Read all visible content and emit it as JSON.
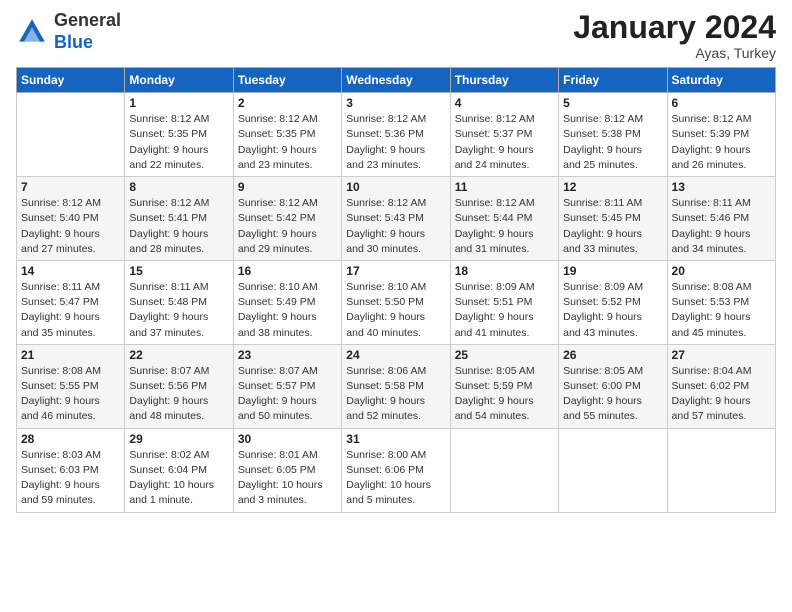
{
  "header": {
    "logo": {
      "general": "General",
      "blue": "Blue"
    },
    "month_title": "January 2024",
    "location": "Ayas, Turkey"
  },
  "weekdays": [
    "Sunday",
    "Monday",
    "Tuesday",
    "Wednesday",
    "Thursday",
    "Friday",
    "Saturday"
  ],
  "weeks": [
    [
      {
        "day": "",
        "info": ""
      },
      {
        "day": "1",
        "info": "Sunrise: 8:12 AM\nSunset: 5:35 PM\nDaylight: 9 hours\nand 22 minutes."
      },
      {
        "day": "2",
        "info": "Sunrise: 8:12 AM\nSunset: 5:35 PM\nDaylight: 9 hours\nand 23 minutes."
      },
      {
        "day": "3",
        "info": "Sunrise: 8:12 AM\nSunset: 5:36 PM\nDaylight: 9 hours\nand 23 minutes."
      },
      {
        "day": "4",
        "info": "Sunrise: 8:12 AM\nSunset: 5:37 PM\nDaylight: 9 hours\nand 24 minutes."
      },
      {
        "day": "5",
        "info": "Sunrise: 8:12 AM\nSunset: 5:38 PM\nDaylight: 9 hours\nand 25 minutes."
      },
      {
        "day": "6",
        "info": "Sunrise: 8:12 AM\nSunset: 5:39 PM\nDaylight: 9 hours\nand 26 minutes."
      }
    ],
    [
      {
        "day": "7",
        "info": "Sunrise: 8:12 AM\nSunset: 5:40 PM\nDaylight: 9 hours\nand 27 minutes."
      },
      {
        "day": "8",
        "info": "Sunrise: 8:12 AM\nSunset: 5:41 PM\nDaylight: 9 hours\nand 28 minutes."
      },
      {
        "day": "9",
        "info": "Sunrise: 8:12 AM\nSunset: 5:42 PM\nDaylight: 9 hours\nand 29 minutes."
      },
      {
        "day": "10",
        "info": "Sunrise: 8:12 AM\nSunset: 5:43 PM\nDaylight: 9 hours\nand 30 minutes."
      },
      {
        "day": "11",
        "info": "Sunrise: 8:12 AM\nSunset: 5:44 PM\nDaylight: 9 hours\nand 31 minutes."
      },
      {
        "day": "12",
        "info": "Sunrise: 8:11 AM\nSunset: 5:45 PM\nDaylight: 9 hours\nand 33 minutes."
      },
      {
        "day": "13",
        "info": "Sunrise: 8:11 AM\nSunset: 5:46 PM\nDaylight: 9 hours\nand 34 minutes."
      }
    ],
    [
      {
        "day": "14",
        "info": "Sunrise: 8:11 AM\nSunset: 5:47 PM\nDaylight: 9 hours\nand 35 minutes."
      },
      {
        "day": "15",
        "info": "Sunrise: 8:11 AM\nSunset: 5:48 PM\nDaylight: 9 hours\nand 37 minutes."
      },
      {
        "day": "16",
        "info": "Sunrise: 8:10 AM\nSunset: 5:49 PM\nDaylight: 9 hours\nand 38 minutes."
      },
      {
        "day": "17",
        "info": "Sunrise: 8:10 AM\nSunset: 5:50 PM\nDaylight: 9 hours\nand 40 minutes."
      },
      {
        "day": "18",
        "info": "Sunrise: 8:09 AM\nSunset: 5:51 PM\nDaylight: 9 hours\nand 41 minutes."
      },
      {
        "day": "19",
        "info": "Sunrise: 8:09 AM\nSunset: 5:52 PM\nDaylight: 9 hours\nand 43 minutes."
      },
      {
        "day": "20",
        "info": "Sunrise: 8:08 AM\nSunset: 5:53 PM\nDaylight: 9 hours\nand 45 minutes."
      }
    ],
    [
      {
        "day": "21",
        "info": "Sunrise: 8:08 AM\nSunset: 5:55 PM\nDaylight: 9 hours\nand 46 minutes."
      },
      {
        "day": "22",
        "info": "Sunrise: 8:07 AM\nSunset: 5:56 PM\nDaylight: 9 hours\nand 48 minutes."
      },
      {
        "day": "23",
        "info": "Sunrise: 8:07 AM\nSunset: 5:57 PM\nDaylight: 9 hours\nand 50 minutes."
      },
      {
        "day": "24",
        "info": "Sunrise: 8:06 AM\nSunset: 5:58 PM\nDaylight: 9 hours\nand 52 minutes."
      },
      {
        "day": "25",
        "info": "Sunrise: 8:05 AM\nSunset: 5:59 PM\nDaylight: 9 hours\nand 54 minutes."
      },
      {
        "day": "26",
        "info": "Sunrise: 8:05 AM\nSunset: 6:00 PM\nDaylight: 9 hours\nand 55 minutes."
      },
      {
        "day": "27",
        "info": "Sunrise: 8:04 AM\nSunset: 6:02 PM\nDaylight: 9 hours\nand 57 minutes."
      }
    ],
    [
      {
        "day": "28",
        "info": "Sunrise: 8:03 AM\nSunset: 6:03 PM\nDaylight: 9 hours\nand 59 minutes."
      },
      {
        "day": "29",
        "info": "Sunrise: 8:02 AM\nSunset: 6:04 PM\nDaylight: 10 hours\nand 1 minute."
      },
      {
        "day": "30",
        "info": "Sunrise: 8:01 AM\nSunset: 6:05 PM\nDaylight: 10 hours\nand 3 minutes."
      },
      {
        "day": "31",
        "info": "Sunrise: 8:00 AM\nSunset: 6:06 PM\nDaylight: 10 hours\nand 5 minutes."
      },
      {
        "day": "",
        "info": ""
      },
      {
        "day": "",
        "info": ""
      },
      {
        "day": "",
        "info": ""
      }
    ]
  ]
}
